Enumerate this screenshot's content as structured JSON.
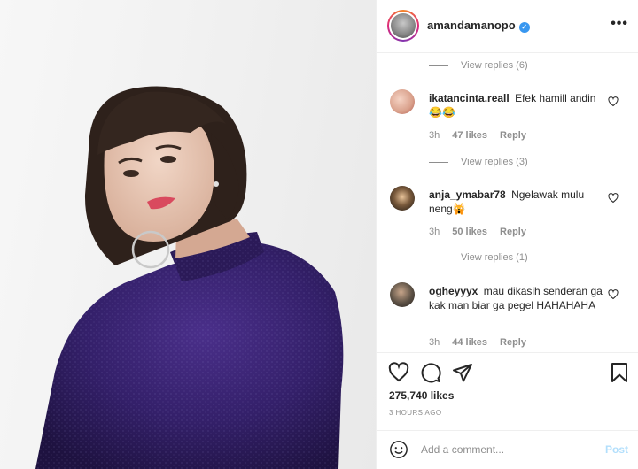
{
  "post": {
    "username": "amandamanopo",
    "verified": true,
    "more_label": "•••"
  },
  "comments": [
    {
      "type": "replies",
      "label": "View replies (6)"
    },
    {
      "type": "comment",
      "username": "ikatancinta.reall",
      "text": "Efek hamill andin 😂😂",
      "time": "3h",
      "likes": "47 likes",
      "reply": "Reply",
      "avatar_color": "#d9a08b"
    },
    {
      "type": "replies",
      "label": "View replies (3)"
    },
    {
      "type": "comment",
      "username": "anja_ymabar78",
      "text": "Ngelawak mulu neng🙀",
      "time": "3h",
      "likes": "50 likes",
      "reply": "Reply",
      "avatar_color": "#3a3026"
    },
    {
      "type": "replies",
      "label": "View replies (1)"
    },
    {
      "type": "comment",
      "username": "ogheyyyx",
      "text": "mau dikasih senderan ga kak man biar ga pegel HAHAHAHA",
      "time": "3h",
      "likes": "44 likes",
      "reply": "Reply",
      "avatar_color": "#5b5044"
    }
  ],
  "actions": {
    "icons": [
      "heart-icon",
      "comment-icon",
      "share-icon",
      "bookmark-icon"
    ],
    "likes": "275,740 likes",
    "time": "3 HOURS AGO"
  },
  "add_comment": {
    "placeholder": "Add a comment...",
    "post_label": "Post"
  },
  "colors": {
    "verified": "#3897f0",
    "post_disabled": "#b2dffc",
    "muted": "#8e8e8e",
    "sweater": "#3b2470"
  }
}
